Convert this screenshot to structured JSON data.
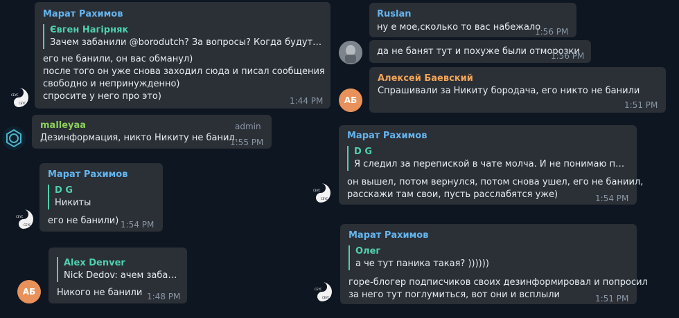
{
  "colors": {
    "background": "#0e1621",
    "bubble": "#2b2f36",
    "name_blue": "#64b5ef",
    "name_green": "#8ccf5c",
    "name_orange": "#f1a457",
    "quote_teal": "#4fd1b0",
    "time": "#8a97a5",
    "avatar_orange": "#e8915a"
  },
  "avatars": {
    "ab_initials": "АБ"
  },
  "messages": [
    {
      "sender": "Марат Рахимов",
      "quote_name": "Євген Нагірняк",
      "quote_text": "Зачем забанили @borodutch? За вопросы? Когда будут офф ...",
      "lines": [
        "его не банили, он вас обманул)",
        "после того он уже снова заходил сюда и писал сообщения",
        "свободно и непринужденно)",
        "спросите у него про это)"
      ],
      "time": "1:44 PM"
    },
    {
      "sender": "malleyaa",
      "tag": "admin",
      "lines": [
        "Дезинформация, никто Никиту не банил."
      ],
      "time": "1:55 PM"
    },
    {
      "sender": "Марат Рахимов",
      "quote_name": "D G",
      "quote_text": "Никиты",
      "lines": [
        "его не банили)"
      ],
      "time": "1:54 PM"
    },
    {
      "sender": "",
      "quote_name": "Alex Denver",
      "quote_text": "Nick Dedov: ачем забан...",
      "lines": [
        "Никого не банили"
      ],
      "time": "1:48 PM"
    },
    {
      "sender": "Ruslan",
      "lines": [
        "ну е мое,сколько то вас набежало"
      ],
      "time": "1:56 PM"
    },
    {
      "sender": "",
      "lines": [
        "да не банят тут и похуже были отморозки"
      ],
      "time": "1:56 PM"
    },
    {
      "sender": "Алексей Баевский",
      "lines": [
        "Спрашивали за Никиту бородача, его никто не банили"
      ],
      "time": "1:51 PM"
    },
    {
      "sender": "Марат Рахимов",
      "quote_name": "D G",
      "quote_text": "Я следил за перепиской в чате молча. И не понимаю почем...",
      "lines": [
        "он вышел, потом вернулся, потом снова ушел, его не баниил,",
        "расскажи там свои, пусть расслабятся уже)"
      ],
      "time": "1:54 PM"
    },
    {
      "sender": "Марат Рахимов",
      "quote_name": "Олег",
      "quote_text": "а че тут паника такая? ))))))",
      "lines": [
        "горе-блогер подписчиков своих дезинформировал и попросил",
        "за него тут поглумиться, вот они и всплыли"
      ],
      "time": "1:51 PM"
    }
  ]
}
